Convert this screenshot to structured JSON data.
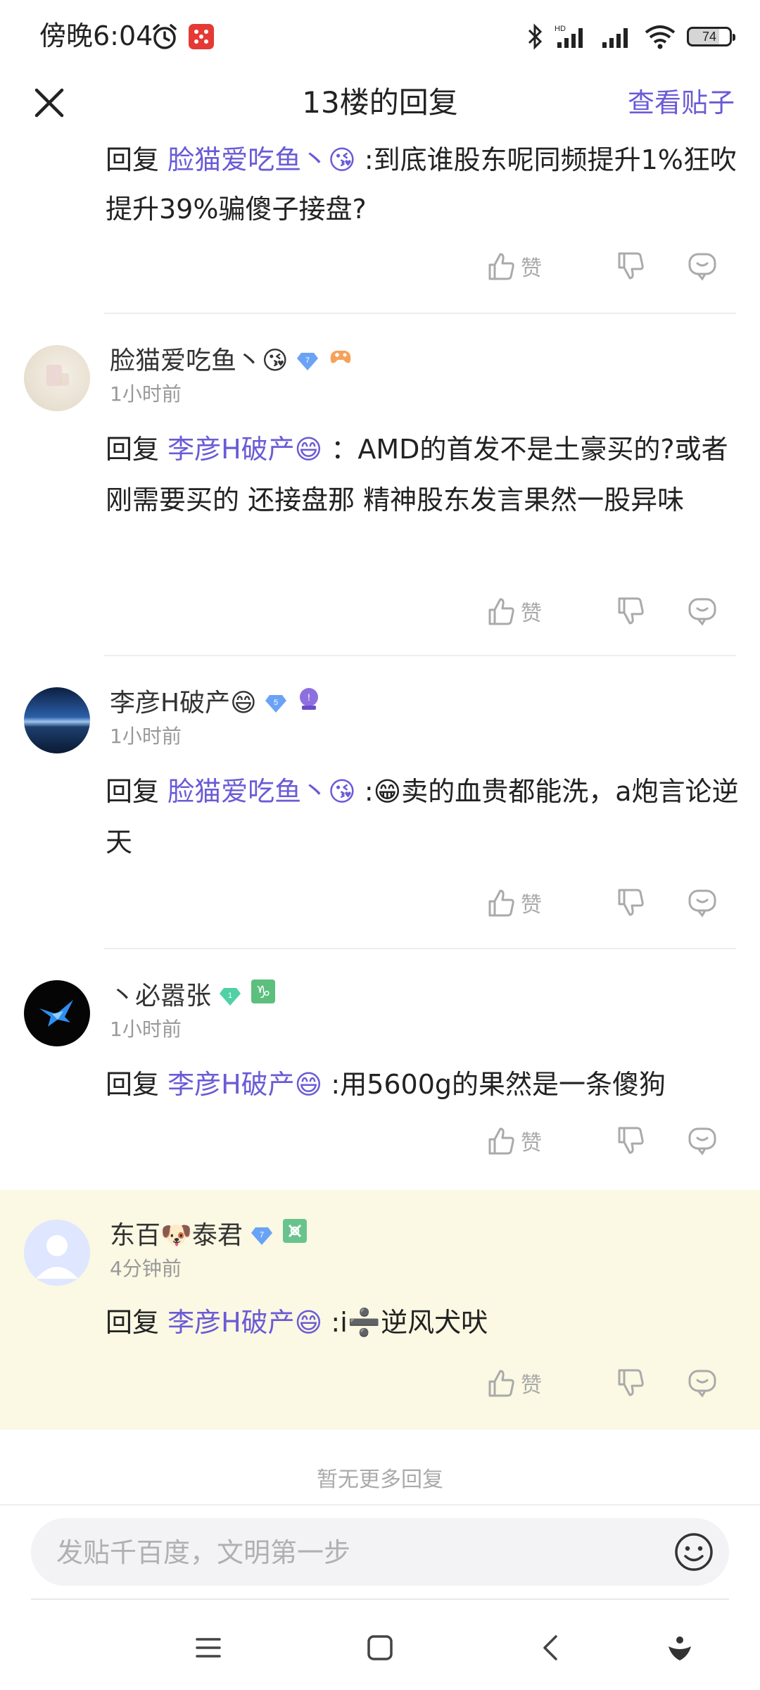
{
  "status_bar": {
    "time": "傍晚6:04",
    "battery": "74"
  },
  "header": {
    "title": "13楼的回复",
    "view_post_label": "查看贴子"
  },
  "actions": {
    "like_label": "赞"
  },
  "replies": [
    {
      "reply_prefix": "回复",
      "mention": "脸猫爱吃鱼丶😘",
      "text": " :到底谁股东呢同频提升1%狂吹提升39%骗傻子接盘?"
    },
    {
      "username": "脸猫爱吃鱼丶😘",
      "level": "7",
      "timestamp": "1小时前",
      "reply_prefix": "回复",
      "mention": "李彦H破产😄",
      "text": " ：AMD的首发不是土豪买的?或者刚需要买的 还接盘那 精神股东发言果然一股异味"
    },
    {
      "username": "李彦H破产😄",
      "level": "5",
      "timestamp": "1小时前",
      "reply_prefix": "回复",
      "mention": "脸猫爱吃鱼丶😘",
      "text": " :😁卖的血贵都能洗，a炮言论逆天"
    },
    {
      "username": "丶必嚣张",
      "level": "1",
      "timestamp": "1小时前",
      "reply_prefix": "回复",
      "mention": "李彦H破产😄",
      "text": " :用5600g的果然是一条傻狗"
    },
    {
      "username": "东百🐶泰君",
      "level": "7",
      "timestamp": "4分钟前",
      "reply_prefix": "回复",
      "mention": "李彦H破产😄",
      "text": " :i➗逆风犬吠"
    }
  ],
  "no_more_text": "暂无更多回复",
  "input": {
    "placeholder": "发贴千百度，文明第一步"
  },
  "colors": {
    "accent": "#6a5bd6",
    "highlight_bg": "#fbf8e3",
    "muted": "#aaaaaa"
  },
  "icons": {
    "close": "close-icon",
    "like": "thumbs-up-icon",
    "dislike": "thumbs-down-icon",
    "comment": "comment-icon",
    "emoji": "smiley-icon",
    "nav_menu": "menu-icon",
    "nav_home": "home-square-icon",
    "nav_back": "back-chevron-icon",
    "nav_assistant": "assistant-icon"
  }
}
